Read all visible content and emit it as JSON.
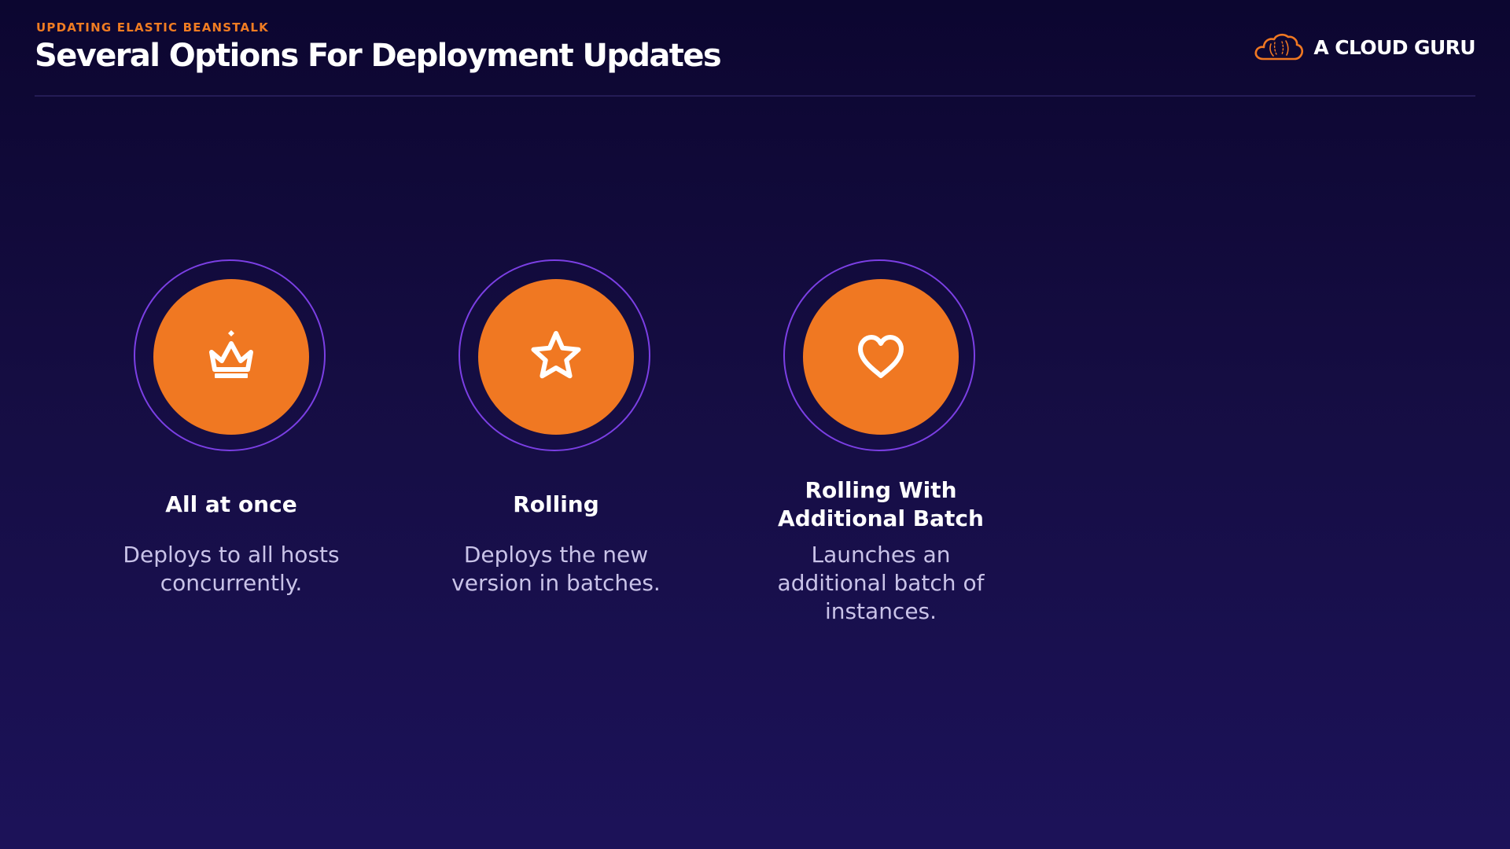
{
  "header": {
    "eyebrow": "UPDATING ELASTIC BEANSTALK",
    "title": "Several Options For Deployment Updates"
  },
  "brand": {
    "name": "A CLOUD GURU",
    "logo_icon": "cloud-logo-icon"
  },
  "colors": {
    "accent": "#f07822",
    "ring": "#7b3fe4",
    "background": "#150d42",
    "description": "#c9c3e8"
  },
  "options": [
    {
      "icon": "crown-icon",
      "title": "All at once",
      "description": "Deploys to all hosts concurrently."
    },
    {
      "icon": "star-icon",
      "title": "Rolling",
      "description": "Deploys the new version in batches."
    },
    {
      "icon": "heart-icon",
      "title": "Rolling With Additional Batch",
      "description": "Launches an additional batch of instances."
    }
  ]
}
